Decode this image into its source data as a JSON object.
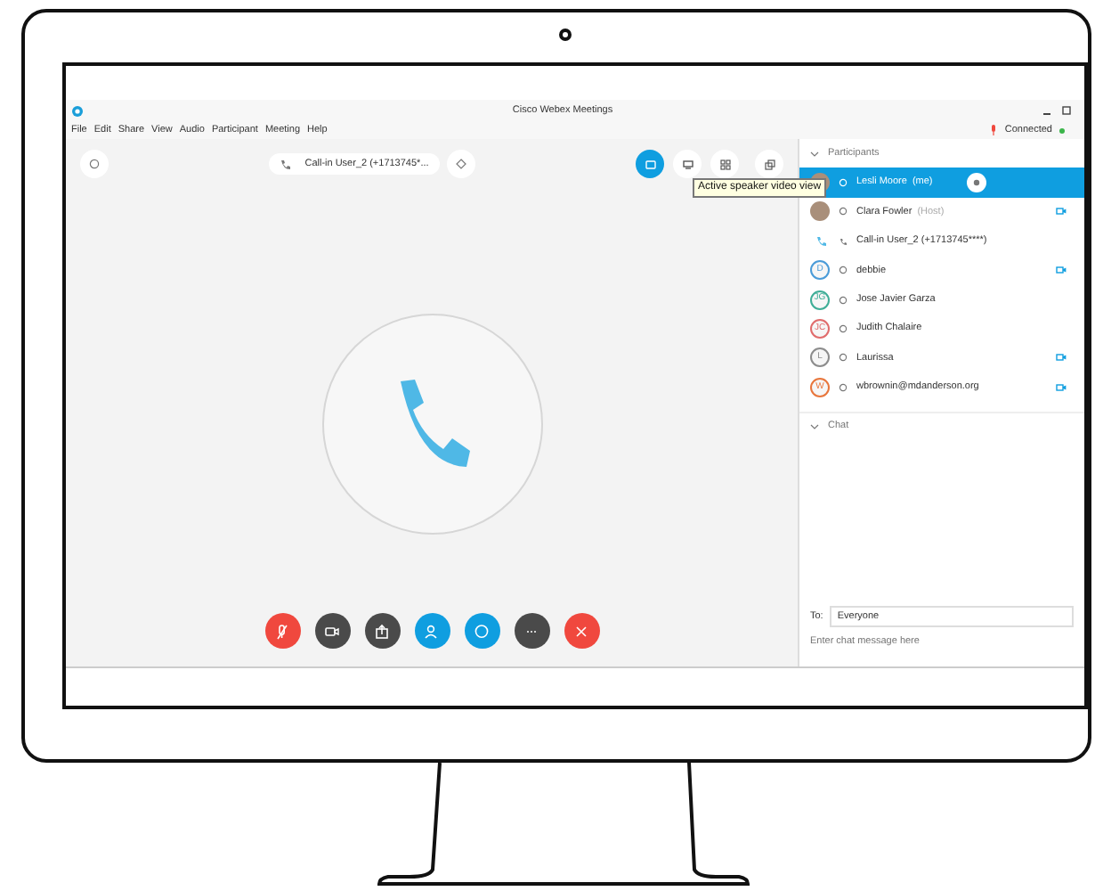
{
  "window": {
    "title": "Cisco Webex Meetings"
  },
  "menu": [
    "File",
    "Edit",
    "Share",
    "View",
    "Audio",
    "Participant",
    "Meeting",
    "Help"
  ],
  "status": "Connected",
  "call_pill": "Call-in User_2 (+1713745*...",
  "view_buttons": [
    {
      "kind": "speaker",
      "selected": true
    },
    {
      "kind": "grid",
      "selected": false
    },
    {
      "kind": "thumbs",
      "selected": false
    },
    {
      "kind": "popout",
      "selected": false
    }
  ],
  "tooltip": "Active speaker video view",
  "participants": {
    "title": "Participants",
    "expanded": true,
    "items": [
      {
        "kind": "photo",
        "name": "Lesli Moore",
        "note": "(me)",
        "selected": true,
        "video": false,
        "badge": true
      },
      {
        "kind": "photo",
        "name": "Clara Fowler",
        "note": "(Host)",
        "selected": false,
        "video": true,
        "badge": false
      },
      {
        "kind": "phone",
        "name": "Call-in User_2 (+1713745****)",
        "selected": false,
        "video": false,
        "badge": false
      },
      {
        "kind": "initials",
        "initials": "D",
        "color": "#4a9bd8",
        "name": "debbie",
        "selected": false,
        "video": true,
        "badge": false
      },
      {
        "kind": "initials",
        "initials": "JG",
        "color": "#3fae97",
        "name": "Jose Javier Garza",
        "selected": false,
        "video": false,
        "badge": false
      },
      {
        "kind": "initials",
        "initials": "JC",
        "color": "#e06c6c",
        "name": "Judith Chalaire",
        "selected": false,
        "video": false,
        "badge": false
      },
      {
        "kind": "initials",
        "initials": "L",
        "color": "#8c8c8c",
        "name": "Laurissa",
        "selected": false,
        "video": true,
        "badge": false
      },
      {
        "kind": "initials",
        "initials": "W",
        "color": "#e8763c",
        "name": "wbrownin@mdanderson.org",
        "selected": false,
        "video": true,
        "badge": false
      }
    ]
  },
  "chat": {
    "title": "Chat",
    "expanded": true,
    "to_label": "To:",
    "to_value": "Everyone",
    "placeholder": "Enter chat message here"
  },
  "controls": [
    {
      "kind": "mic",
      "color": "#f0483e"
    },
    {
      "kind": "video",
      "color": "#4a4a4a"
    },
    {
      "kind": "share",
      "color": "#4a4a4a"
    },
    {
      "kind": "people",
      "color": "#0f9ee0"
    },
    {
      "kind": "chat",
      "color": "#0f9ee0"
    },
    {
      "kind": "more",
      "color": "#4a4a4a"
    },
    {
      "kind": "leave",
      "color": "#f0483e"
    }
  ]
}
